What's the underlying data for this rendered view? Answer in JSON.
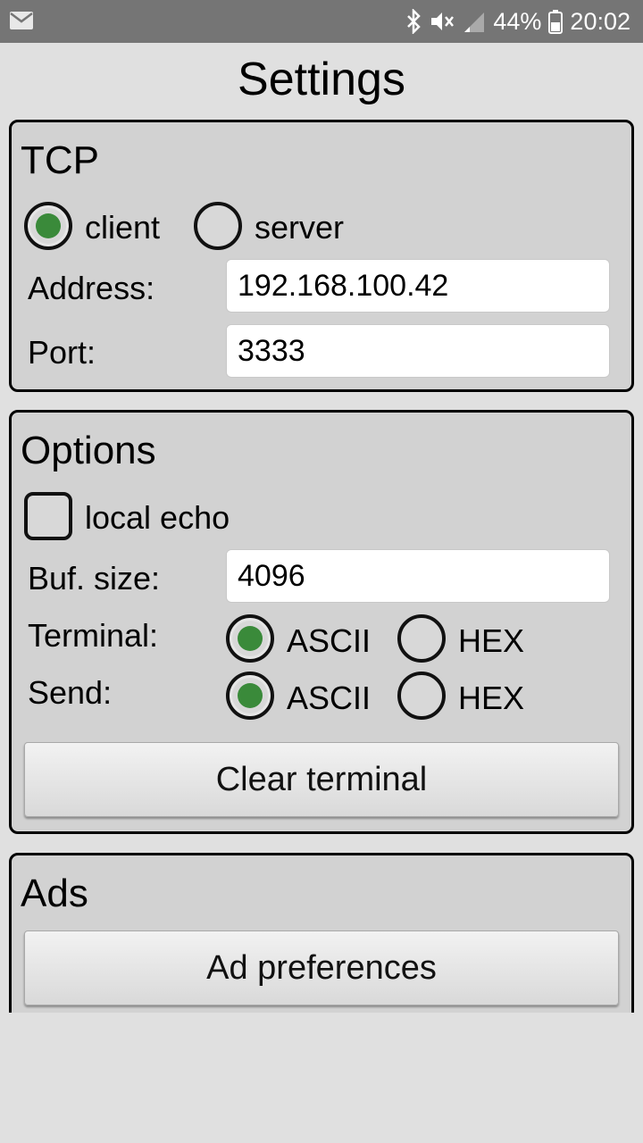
{
  "status_bar": {
    "battery_percent": "44%",
    "time": "20:02",
    "icons": [
      "mail-icon",
      "bluetooth-icon",
      "mute-icon",
      "signal-icon",
      "battery-icon"
    ]
  },
  "page": {
    "title": "Settings"
  },
  "tcp": {
    "title": "TCP",
    "mode": {
      "options": [
        "client",
        "server"
      ],
      "selected": "client"
    },
    "address_label": "Address:",
    "address_value": "192.168.100.42",
    "port_label": "Port:",
    "port_value": "3333"
  },
  "options": {
    "title": "Options",
    "local_echo_label": "local echo",
    "local_echo_checked": false,
    "buf_size_label": "Buf. size:",
    "buf_size_value": "4096",
    "terminal_label": "Terminal:",
    "terminal_options": [
      "ASCII",
      "HEX"
    ],
    "terminal_selected": "ASCII",
    "send_label": "Send:",
    "send_options": [
      "ASCII",
      "HEX"
    ],
    "send_selected": "ASCII",
    "clear_button": "Clear terminal"
  },
  "ads": {
    "title": "Ads",
    "preferences_button": "Ad preferences"
  },
  "colors": {
    "radio_checked": "#3a8a3a",
    "status_bar": "#757575",
    "background": "#e0e0e0"
  }
}
